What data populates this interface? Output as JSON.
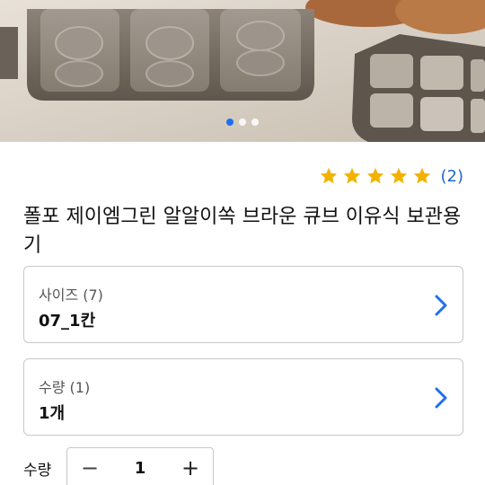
{
  "product": {
    "title": "폴포 제이엠그린 알알이쏙 브라운 큐브 이유식 보관용기",
    "review_count": "(2)",
    "rating": 5,
    "rating_max": 5
  },
  "carousel": {
    "image": "product-photo-brown-cube-containers",
    "dot_count": 3,
    "active_index": 0,
    "active_color": "#1e6ff0"
  },
  "options": [
    {
      "label": "사이즈 (7)",
      "value": "07_1칸",
      "icon": "chevron-right-icon"
    },
    {
      "label": "수량 (1)",
      "value": "1개",
      "icon": "chevron-right-icon"
    }
  ],
  "quantity": {
    "label": "수량",
    "value": "1",
    "minus": "−",
    "plus": "+"
  },
  "colors": {
    "star": "#f2b300",
    "link": "#2266cc",
    "chevron": "#1e6ff0"
  }
}
